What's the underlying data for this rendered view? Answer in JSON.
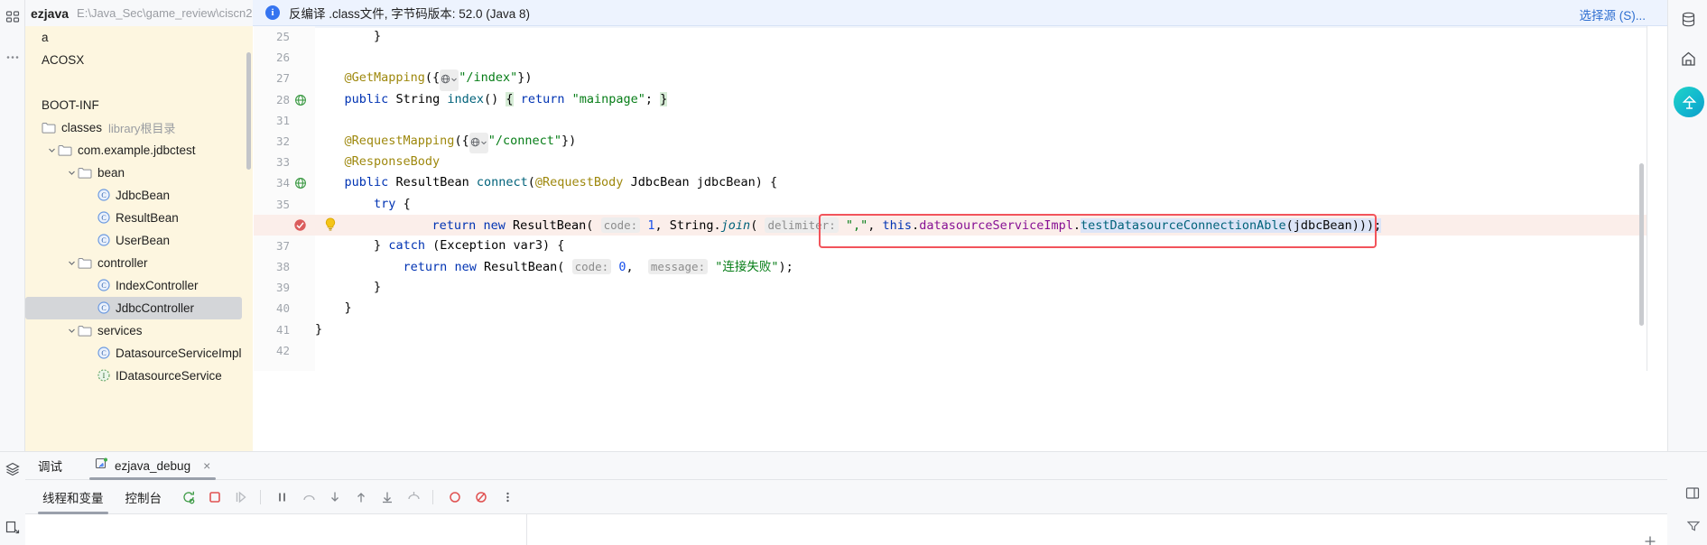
{
  "window": {
    "project_name": "ezjava",
    "project_path": "E:\\Java_Sec\\game_review\\ciscn2"
  },
  "banner": {
    "icon": "info-icon",
    "text": "反编译 .class文件, 字节码版本: 52.0 (Java 8)",
    "action_label": "选择源 (S)..."
  },
  "project_tree": [
    {
      "label": "a",
      "indent": 0,
      "icon": "none",
      "chevron": "",
      "selected": false,
      "sub": ""
    },
    {
      "label": "ACOSX",
      "indent": 0,
      "icon": "none",
      "chevron": "",
      "selected": false,
      "sub": ""
    },
    {
      "label": "",
      "indent": 0,
      "icon": "none",
      "chevron": "",
      "selected": false,
      "sub": ""
    },
    {
      "label": "BOOT-INF",
      "indent": 0,
      "icon": "none",
      "chevron": "",
      "selected": false,
      "sub": ""
    },
    {
      "label": "classes",
      "indent": 0,
      "icon": "folder-icon",
      "chevron": "",
      "selected": false,
      "sub": "library根目录"
    },
    {
      "label": "com.example.jdbctest",
      "indent": 1,
      "icon": "folder-icon",
      "chevron": "chevron-down-icon",
      "selected": false,
      "sub": ""
    },
    {
      "label": "bean",
      "indent": 2,
      "icon": "folder-icon",
      "chevron": "chevron-down-icon",
      "selected": false,
      "sub": ""
    },
    {
      "label": "JdbcBean",
      "indent": 3,
      "icon": "class-icon",
      "chevron": "",
      "selected": false,
      "sub": ""
    },
    {
      "label": "ResultBean",
      "indent": 3,
      "icon": "class-icon",
      "chevron": "",
      "selected": false,
      "sub": ""
    },
    {
      "label": "UserBean",
      "indent": 3,
      "icon": "class-icon",
      "chevron": "",
      "selected": false,
      "sub": ""
    },
    {
      "label": "controller",
      "indent": 2,
      "icon": "folder-icon",
      "chevron": "chevron-down-icon",
      "selected": false,
      "sub": ""
    },
    {
      "label": "IndexController",
      "indent": 3,
      "icon": "class-icon",
      "chevron": "",
      "selected": false,
      "sub": ""
    },
    {
      "label": "JdbcController",
      "indent": 3,
      "icon": "class-icon",
      "chevron": "",
      "selected": true,
      "sub": ""
    },
    {
      "label": "services",
      "indent": 2,
      "icon": "folder-icon",
      "chevron": "chevron-down-icon",
      "selected": false,
      "sub": ""
    },
    {
      "label": "DatasourceServiceImpl",
      "indent": 3,
      "icon": "class-icon",
      "chevron": "",
      "selected": false,
      "sub": ""
    },
    {
      "label": "IDatasourceService",
      "indent": 3,
      "icon": "interface-icon",
      "chevron": "",
      "selected": false,
      "sub": ""
    }
  ],
  "editor": {
    "lines": [
      {
        "num": "25",
        "marker": "",
        "html": "        <span class=\"plain\">}</span>"
      },
      {
        "num": "26",
        "marker": "",
        "html": ""
      },
      {
        "num": "27",
        "marker": "",
        "html": "    <span class=\"anno\">@GetMapping</span><span class=\"plain\">({</span><span class=\"globe\">GLOBE</span><span class=\"str\">\"/index\"</span><span class=\"plain\">})</span>"
      },
      {
        "num": "28",
        "marker": "run",
        "html": "    <span class=\"kw\">public</span> <span class=\"typ\">String</span> <span class=\"mth\">index</span><span class=\"plain\">()</span> <span class=\"brace-hl\">{</span> <span class=\"kw\">return</span> <span class=\"str\">\"mainpage\"</span><span class=\"plain\">;</span> <span class=\"brace-hl\">}</span>"
      },
      {
        "num": "31",
        "marker": "",
        "html": ""
      },
      {
        "num": "32",
        "marker": "",
        "html": "    <span class=\"anno\">@RequestMapping</span><span class=\"plain\">({</span><span class=\"globe\">GLOBE</span><span class=\"str\">\"/connect\"</span><span class=\"plain\">})</span>"
      },
      {
        "num": "33",
        "marker": "",
        "html": "    <span class=\"anno\">@ResponseBody</span>"
      },
      {
        "num": "34",
        "marker": "run",
        "html": "    <span class=\"kw\">public</span> <span class=\"typ\">ResultBean</span> <span class=\"mth\">connect</span><span class=\"plain\">(</span><span class=\"anno\">@RequestBody</span> <span class=\"typ\">JdbcBean</span> <span class=\"plain\">jdbcBean) {</span>"
      },
      {
        "num": "35",
        "marker": "",
        "html": "        <span class=\"kw\">try</span> <span class=\"plain\">{</span>"
      },
      {
        "num": "",
        "marker": "breakpoint-bulb",
        "highlight": true,
        "html": "            <span class=\"kw\">return</span> <span class=\"kw\">new</span> <span class=\"typ\">ResultBean</span><span class=\"plain\">(</span> <span class=\"hint\">code:</span> <span class=\"num\">1</span><span class=\"plain\">,</span> <span class=\"typ\">String.</span><span class=\"mth\"><i>join</i></span><span class=\"plain\">(</span> <span class=\"hint\">delimiter:</span> <span class=\"str\">\",\"</span><span class=\"plain\">,</span> <span class=\"kw\">this</span><span class=\"plain\">.</span><span class=\"fld\">datasourceServiceImpl</span><span class=\"plain\">.</span><span class=\"sel-bg\"><span class=\"mth\">testDatasourceConnectionAble</span><span class=\"plain\">(jdbcBean)));</span></span>"
      },
      {
        "num": "37",
        "marker": "",
        "html": "        <span class=\"plain\">}</span> <span class=\"kw\">catch</span> <span class=\"plain\">(</span><span class=\"typ\">Exception</span> <span class=\"plain\">var3) {</span>"
      },
      {
        "num": "38",
        "marker": "",
        "html": "            <span class=\"kw\">return</span> <span class=\"kw\">new</span> <span class=\"typ\">ResultBean</span><span class=\"plain\">(</span> <span class=\"hint\">code:</span> <span class=\"num\">0</span><span class=\"plain\">,</span>  <span class=\"hint\">message:</span> <span class=\"str\">\"连接失败\"</span><span class=\"plain\">);</span>"
      },
      {
        "num": "39",
        "marker": "",
        "html": "        <span class=\"plain\">}</span>"
      },
      {
        "num": "40",
        "marker": "",
        "html": "    <span class=\"plain\">}</span>"
      },
      {
        "num": "41",
        "marker": "",
        "html": "<span class=\"plain\">}</span>"
      },
      {
        "num": "42",
        "marker": "",
        "html": ""
      }
    ],
    "highlight_box_label": "this.datasourceServiceImpl.testDatasourceConnectionAble(jdbcBean)));"
  },
  "debug_panel": {
    "title": "调试",
    "tab_label": "ezjava_debug",
    "tab_close": "×",
    "tabs": [
      {
        "label": "线程和变量",
        "active": true
      },
      {
        "label": "控制台",
        "active": false
      }
    ],
    "buttons": [
      {
        "name": "rerun-button",
        "icon": "rerun-icon"
      },
      {
        "name": "stop-button",
        "icon": "stop-icon"
      },
      {
        "name": "resume-button",
        "icon": "resume-icon"
      },
      {
        "name": "pause-button",
        "icon": "pause-icon"
      },
      {
        "name": "step-over-button",
        "icon": "step-over-icon"
      },
      {
        "name": "step-into-button",
        "icon": "step-into-icon"
      },
      {
        "name": "force-step-into-button",
        "icon": "force-step-into-icon"
      },
      {
        "name": "step-out-button",
        "icon": "step-out-icon"
      },
      {
        "name": "run-to-cursor-button",
        "icon": "run-to-cursor-icon"
      },
      {
        "name": "view-breakpoints-button",
        "icon": "breakpoint-icon"
      },
      {
        "name": "mute-breakpoints-button",
        "icon": "mute-breakpoint-icon"
      },
      {
        "name": "more-button",
        "icon": "more-vertical-icon"
      }
    ]
  },
  "colors": {
    "accent_blue": "#3574f0",
    "banner_bg": "#edf3fe",
    "tree_bg": "#fdf6e0",
    "highlight_red": "#f2545b",
    "selection_bg": "#dce4f7",
    "exec_line_bg": "#fbeeea"
  }
}
